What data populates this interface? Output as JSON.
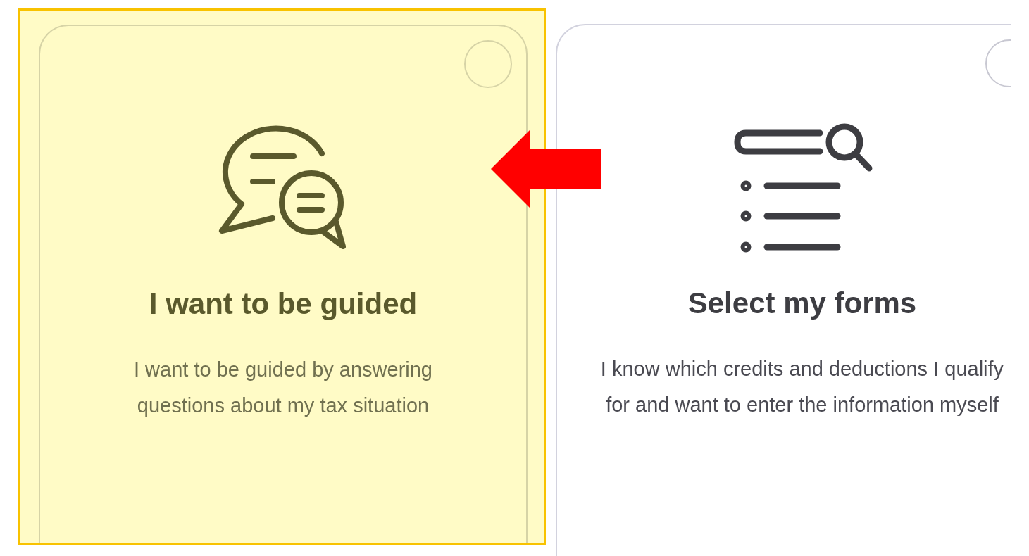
{
  "options": [
    {
      "kind": "guided",
      "title": "I want to be guided",
      "description": "I want to be guided by answering questions about my tax situation",
      "selected": false,
      "highlighted": true,
      "arrow_pointing": true
    },
    {
      "kind": "forms",
      "title": "Select my forms",
      "description": "I know which credits and deductions I qualify for and want to enter the information myself",
      "selected": false,
      "highlighted": false,
      "arrow_pointing": false
    }
  ]
}
